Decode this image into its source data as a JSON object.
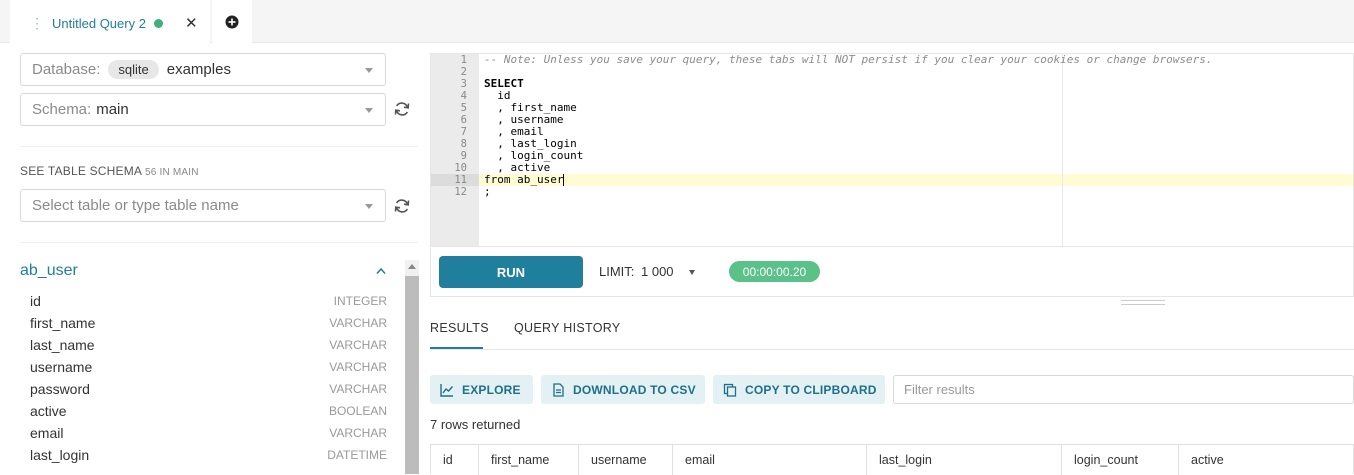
{
  "tabs": {
    "active": {
      "title": "Untitled Query 2",
      "drag_handle": "⋮"
    },
    "close_glyph": "✕"
  },
  "left_panel": {
    "database": {
      "label": "Database:",
      "backend": "sqlite",
      "value": "examples"
    },
    "schema": {
      "label": "Schema:",
      "value": "main"
    },
    "table_schema_heading": "SEE TABLE SCHEMA",
    "table_schema_count": "56 IN MAIN",
    "table_select_placeholder": "Select table or type table name",
    "table": {
      "name": "ab_user",
      "columns": [
        {
          "name": "id",
          "type": "INTEGER"
        },
        {
          "name": "first_name",
          "type": "VARCHAR"
        },
        {
          "name": "last_name",
          "type": "VARCHAR"
        },
        {
          "name": "username",
          "type": "VARCHAR"
        },
        {
          "name": "password",
          "type": "VARCHAR"
        },
        {
          "name": "active",
          "type": "BOOLEAN"
        },
        {
          "name": "email",
          "type": "VARCHAR"
        },
        {
          "name": "last_login",
          "type": "DATETIME"
        }
      ]
    }
  },
  "editor": {
    "line_numbers": [
      "1",
      "2",
      "3",
      "4",
      "5",
      "6",
      "7",
      "8",
      "9",
      "10",
      "11",
      "12"
    ],
    "lines": [
      "-- Note: Unless you save your query, these tabs will NOT persist if you clear your cookies or change browsers.",
      "",
      "SELECT",
      "  id",
      "  , first_name",
      "  , username",
      "  , email",
      "  , last_login",
      "  , login_count",
      "  , active",
      "from ab_user",
      ";"
    ]
  },
  "toolbar": {
    "run_label": "RUN",
    "limit_label": "LIMIT:",
    "limit_value": "1 000",
    "timer": "00:00:00.20"
  },
  "results": {
    "tabs": [
      "RESULTS",
      "QUERY HISTORY"
    ],
    "actions": {
      "explore": "EXPLORE",
      "download": "DOWNLOAD TO CSV",
      "copy": "COPY TO CLIPBOARD"
    },
    "filter_placeholder": "Filter results",
    "rows_returned": "7 rows returned",
    "columns": [
      "id",
      "first_name",
      "username",
      "email",
      "last_login",
      "login_count",
      "active"
    ]
  },
  "colors": {
    "accent": "#1f7f9c",
    "success": "#5ac189",
    "status_dot": "#3fb07b"
  }
}
